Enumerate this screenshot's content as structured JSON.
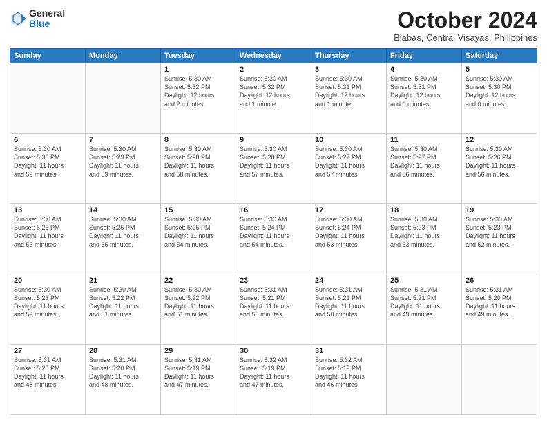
{
  "header": {
    "logo_general": "General",
    "logo_blue": "Blue",
    "month_title": "October 2024",
    "location": "Biabas, Central Visayas, Philippines"
  },
  "days_of_week": [
    "Sunday",
    "Monday",
    "Tuesday",
    "Wednesday",
    "Thursday",
    "Friday",
    "Saturday"
  ],
  "weeks": [
    [
      {
        "day": "",
        "info": ""
      },
      {
        "day": "",
        "info": ""
      },
      {
        "day": "1",
        "info": "Sunrise: 5:30 AM\nSunset: 5:32 PM\nDaylight: 12 hours\nand 2 minutes."
      },
      {
        "day": "2",
        "info": "Sunrise: 5:30 AM\nSunset: 5:32 PM\nDaylight: 12 hours\nand 1 minute."
      },
      {
        "day": "3",
        "info": "Sunrise: 5:30 AM\nSunset: 5:31 PM\nDaylight: 12 hours\nand 1 minute."
      },
      {
        "day": "4",
        "info": "Sunrise: 5:30 AM\nSunset: 5:31 PM\nDaylight: 12 hours\nand 0 minutes."
      },
      {
        "day": "5",
        "info": "Sunrise: 5:30 AM\nSunset: 5:30 PM\nDaylight: 12 hours\nand 0 minutes."
      }
    ],
    [
      {
        "day": "6",
        "info": "Sunrise: 5:30 AM\nSunset: 5:30 PM\nDaylight: 11 hours\nand 59 minutes."
      },
      {
        "day": "7",
        "info": "Sunrise: 5:30 AM\nSunset: 5:29 PM\nDaylight: 11 hours\nand 59 minutes."
      },
      {
        "day": "8",
        "info": "Sunrise: 5:30 AM\nSunset: 5:28 PM\nDaylight: 11 hours\nand 58 minutes."
      },
      {
        "day": "9",
        "info": "Sunrise: 5:30 AM\nSunset: 5:28 PM\nDaylight: 11 hours\nand 57 minutes."
      },
      {
        "day": "10",
        "info": "Sunrise: 5:30 AM\nSunset: 5:27 PM\nDaylight: 11 hours\nand 57 minutes."
      },
      {
        "day": "11",
        "info": "Sunrise: 5:30 AM\nSunset: 5:27 PM\nDaylight: 11 hours\nand 56 minutes."
      },
      {
        "day": "12",
        "info": "Sunrise: 5:30 AM\nSunset: 5:26 PM\nDaylight: 11 hours\nand 56 minutes."
      }
    ],
    [
      {
        "day": "13",
        "info": "Sunrise: 5:30 AM\nSunset: 5:26 PM\nDaylight: 11 hours\nand 55 minutes."
      },
      {
        "day": "14",
        "info": "Sunrise: 5:30 AM\nSunset: 5:25 PM\nDaylight: 11 hours\nand 55 minutes."
      },
      {
        "day": "15",
        "info": "Sunrise: 5:30 AM\nSunset: 5:25 PM\nDaylight: 11 hours\nand 54 minutes."
      },
      {
        "day": "16",
        "info": "Sunrise: 5:30 AM\nSunset: 5:24 PM\nDaylight: 11 hours\nand 54 minutes."
      },
      {
        "day": "17",
        "info": "Sunrise: 5:30 AM\nSunset: 5:24 PM\nDaylight: 11 hours\nand 53 minutes."
      },
      {
        "day": "18",
        "info": "Sunrise: 5:30 AM\nSunset: 5:23 PM\nDaylight: 11 hours\nand 53 minutes."
      },
      {
        "day": "19",
        "info": "Sunrise: 5:30 AM\nSunset: 5:23 PM\nDaylight: 11 hours\nand 52 minutes."
      }
    ],
    [
      {
        "day": "20",
        "info": "Sunrise: 5:30 AM\nSunset: 5:23 PM\nDaylight: 11 hours\nand 52 minutes."
      },
      {
        "day": "21",
        "info": "Sunrise: 5:30 AM\nSunset: 5:22 PM\nDaylight: 11 hours\nand 51 minutes."
      },
      {
        "day": "22",
        "info": "Sunrise: 5:30 AM\nSunset: 5:22 PM\nDaylight: 11 hours\nand 51 minutes."
      },
      {
        "day": "23",
        "info": "Sunrise: 5:31 AM\nSunset: 5:21 PM\nDaylight: 11 hours\nand 50 minutes."
      },
      {
        "day": "24",
        "info": "Sunrise: 5:31 AM\nSunset: 5:21 PM\nDaylight: 11 hours\nand 50 minutes."
      },
      {
        "day": "25",
        "info": "Sunrise: 5:31 AM\nSunset: 5:21 PM\nDaylight: 11 hours\nand 49 minutes."
      },
      {
        "day": "26",
        "info": "Sunrise: 5:31 AM\nSunset: 5:20 PM\nDaylight: 11 hours\nand 49 minutes."
      }
    ],
    [
      {
        "day": "27",
        "info": "Sunrise: 5:31 AM\nSunset: 5:20 PM\nDaylight: 11 hours\nand 48 minutes."
      },
      {
        "day": "28",
        "info": "Sunrise: 5:31 AM\nSunset: 5:20 PM\nDaylight: 11 hours\nand 48 minutes."
      },
      {
        "day": "29",
        "info": "Sunrise: 5:31 AM\nSunset: 5:19 PM\nDaylight: 11 hours\nand 47 minutes."
      },
      {
        "day": "30",
        "info": "Sunrise: 5:32 AM\nSunset: 5:19 PM\nDaylight: 11 hours\nand 47 minutes."
      },
      {
        "day": "31",
        "info": "Sunrise: 5:32 AM\nSunset: 5:19 PM\nDaylight: 11 hours\nand 46 minutes."
      },
      {
        "day": "",
        "info": ""
      },
      {
        "day": "",
        "info": ""
      }
    ]
  ]
}
